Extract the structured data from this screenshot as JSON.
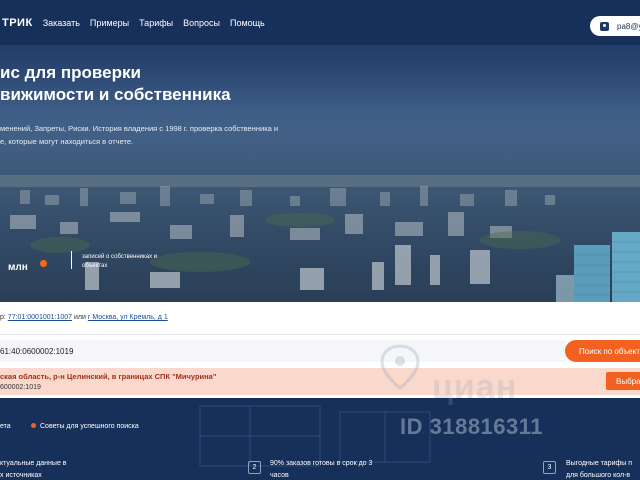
{
  "header": {
    "logo": "ТРИК",
    "nav": [
      "Заказать",
      "Примеры",
      "Тарифы",
      "Вопросы",
      "Помощь"
    ],
    "account_email": "pa8@ya"
  },
  "hero": {
    "title_line1": "ис для проверки",
    "title_line2": "вижимости и собственника",
    "desc_line1": "менений, Запреты, Риски. История владения с 1998 г. проверка собственника и",
    "desc_line2": "е, которые могут находиться в отчете.",
    "stat_value": "млн",
    "stat_label": "записей  о собственниках и объектах"
  },
  "search": {
    "example_prefix": "р:",
    "example_cadastral": "77:01:0001001:1007",
    "example_or": "или",
    "example_address": "г Москва, ул Кремль, д 1",
    "input_value": "61:40:0600002:1019",
    "button_label": "Поиск по объекта",
    "result_title": "ская область, р-н Целинский, в границах СПК \"Мичурина\"",
    "result_id": "600002:1019",
    "select_label": "Выбра"
  },
  "watermark": {
    "brand": "циан",
    "id": "ID 318816311"
  },
  "bottom": {
    "tab1": "ета",
    "tab2": "Советы для успешного поиска",
    "features": [
      {
        "num": "",
        "line1": "ктуальные данные в",
        "line2": "х источниках"
      },
      {
        "num": "2",
        "line1": "90% заказов готовы в срок до 3",
        "line2": "часов"
      },
      {
        "num": "3",
        "line1": "Выгодные тарифы п",
        "line2": "для большого кол-в"
      }
    ]
  }
}
